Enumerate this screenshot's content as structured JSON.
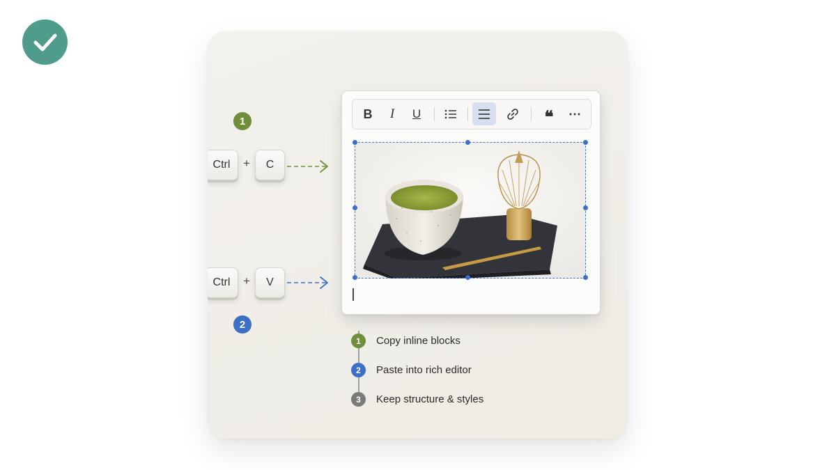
{
  "steps": {
    "copy_number": "1",
    "paste_number": "2"
  },
  "shortcuts": {
    "copy": {
      "modifier": "Ctrl",
      "plus": "+",
      "key": "C"
    },
    "paste": {
      "modifier": "Ctrl",
      "plus": "+",
      "key": "V"
    }
  },
  "toolbar": {
    "items": [
      "bold",
      "italic",
      "underline",
      "bulleted-list",
      "align",
      "link",
      "quote",
      "more"
    ],
    "bold_label": "B",
    "italic_label": "I",
    "underline_label": "U",
    "quote_label": "❝",
    "more_label": "⋯",
    "active_item": "align"
  },
  "legend": [
    {
      "number": "1",
      "label": "Copy inline blocks",
      "color": "#6f8f3b"
    },
    {
      "number": "2",
      "label": "Paste into rich editor",
      "color": "#3d6fc6"
    },
    {
      "number": "3",
      "label": "Keep structure & styles",
      "color": "#7a7a7a"
    }
  ],
  "colors": {
    "accent_teal": "#4f9c8a",
    "step_green": "#6f8f3b",
    "step_blue": "#3d6fc6",
    "step_gray": "#7a7a7a"
  }
}
